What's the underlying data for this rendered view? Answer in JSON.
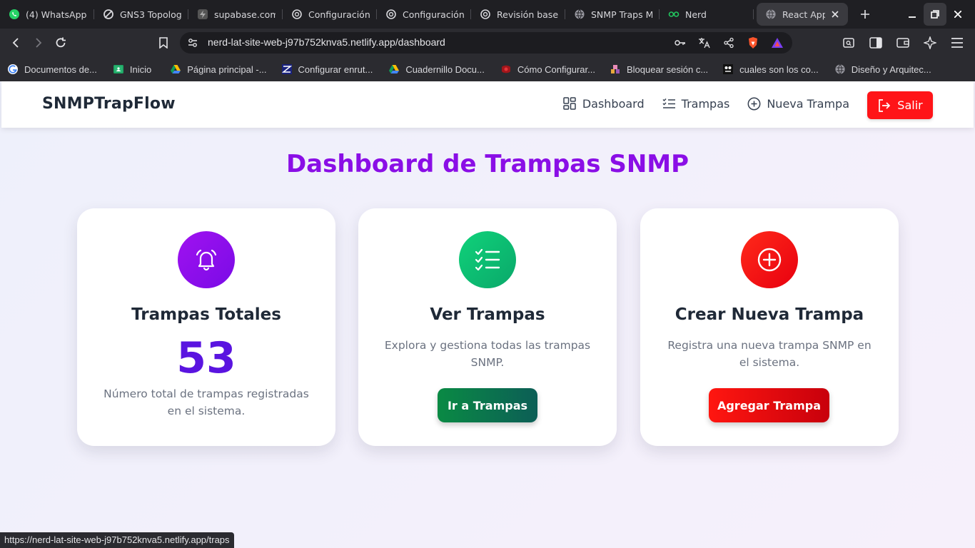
{
  "browser": {
    "tabs": [
      {
        "label": "(4) WhatsApp",
        "icon": "whatsapp-icon"
      },
      {
        "label": "GNS3 Topolog",
        "icon": "gns3-icon"
      },
      {
        "label": "supabase.com",
        "icon": "supabase-icon"
      },
      {
        "label": "Configuración",
        "icon": "openai-icon"
      },
      {
        "label": "Configuración",
        "icon": "openai-icon"
      },
      {
        "label": "Revisión base",
        "icon": "openai-icon"
      },
      {
        "label": "SNMP Traps M",
        "icon": "globe-icon"
      },
      {
        "label": "Nerd",
        "icon": "nerd-glasses-icon"
      },
      {
        "label": "React App",
        "icon": "globe-icon",
        "active": true
      }
    ],
    "url": "nerd-lat-site-web-j97b752knva5.netlify.app/dashboard",
    "bookmarks": [
      {
        "label": "Documentos de...",
        "icon": "google-icon"
      },
      {
        "label": "Inicio",
        "icon": "classroom-icon"
      },
      {
        "label": "Página principal -...",
        "icon": "drive-icon"
      },
      {
        "label": "Configurar enrut...",
        "icon": "site-icon"
      },
      {
        "label": "Cuadernillo Docu...",
        "icon": "drive-icon"
      },
      {
        "label": "Cómo Configurar...",
        "icon": "site-icon"
      },
      {
        "label": "Bloquear sesión c...",
        "icon": "site-icon"
      },
      {
        "label": "cuales son los co...",
        "icon": "site-icon"
      },
      {
        "label": "Diseño y Arquitec...",
        "icon": "globe-icon"
      }
    ],
    "status_url": "https://nerd-lat-site-web-j97b752knva5.netlify.app/traps"
  },
  "app": {
    "brand": "SNMPTrapFlow",
    "nav": {
      "dashboard": "Dashboard",
      "traps": "Trampas",
      "new_trap": "Nueva Trampa",
      "logout": "Salir"
    },
    "title": "Dashboard de Trampas SNMP",
    "cards": {
      "total": {
        "title": "Trampas Totales",
        "count": "53",
        "desc": "Número total de trampas registradas en el sistema."
      },
      "view": {
        "title": "Ver Trampas",
        "desc": "Explora y gestiona todas las trampas SNMP.",
        "button": "Ir a Trampas"
      },
      "create": {
        "title": "Crear Nueva Trampa",
        "desc": "Registra una nueva trampa SNMP en el sistema.",
        "button": "Agregar Trampa"
      }
    },
    "colors": {
      "title": "#8a0ee6",
      "count": "#5a14e0",
      "logout": "#ff1418",
      "view_button": "#0b7a45",
      "create_button": "#e00d0d"
    }
  }
}
